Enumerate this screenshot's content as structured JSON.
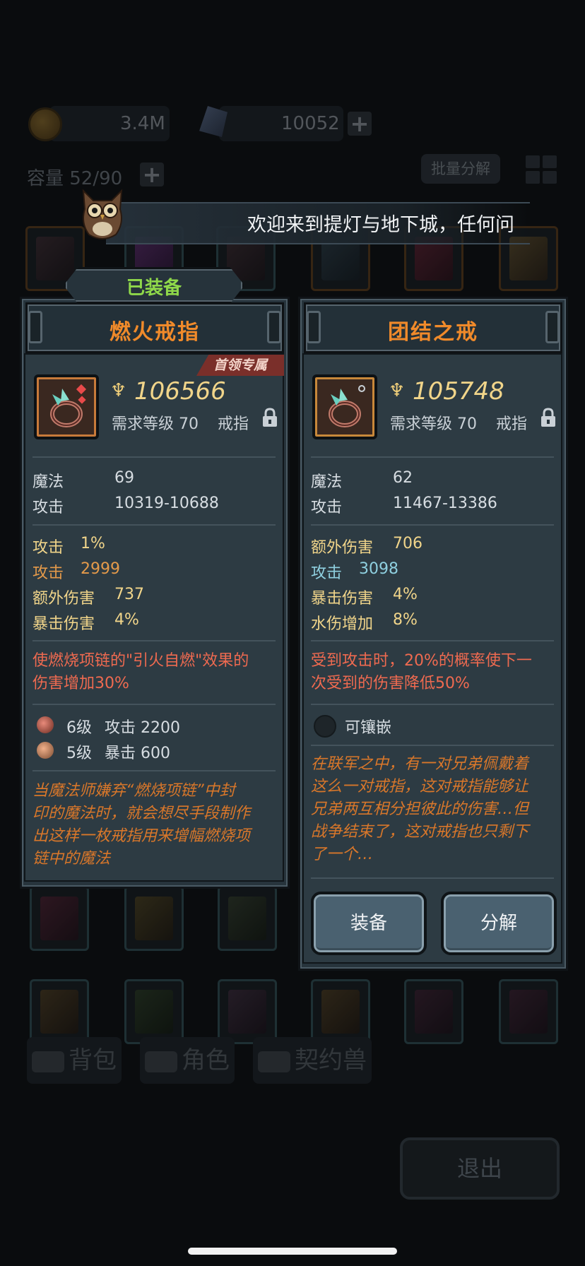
{
  "resources": {
    "coins": "3.4M",
    "gems": "10052"
  },
  "inventory": {
    "capacity": "容量 52/90",
    "batch_button": "批量分解"
  },
  "tabs": [
    {
      "label": "背包"
    },
    {
      "label": "角色"
    },
    {
      "label": "契约兽"
    }
  ],
  "exit_label": "退出",
  "banner_text": "欢迎来到提灯与地下城，任何问",
  "equipped_label": "已装备",
  "left_item": {
    "name": "燃火戒指",
    "tag": "首领专属",
    "score": "106566",
    "requirement": "需求等级 70",
    "type": "戒指",
    "base_stats": [
      {
        "label": "魔法",
        "value": "69"
      },
      {
        "label": "攻击",
        "value": "10319-10688"
      }
    ],
    "bonus_stats": [
      {
        "label": "攻击",
        "value": "1%",
        "color": "#f1d58a"
      },
      {
        "label": "攻击",
        "value": "2999",
        "color": "#e49a4a"
      },
      {
        "label": "额外伤害",
        "value": "737",
        "color": "#f1d58a"
      },
      {
        "label": "暴击伤害",
        "value": "4%",
        "color": "#f1d58a"
      }
    ],
    "effect_lines": [
      "使燃烧项链的\"引火自燃\"效果的",
      "伤害增加30%"
    ],
    "gems": [
      {
        "level": "6级",
        "stat": "攻击 2200"
      },
      {
        "level": "5级",
        "stat": "暴击 600"
      }
    ],
    "flavor_lines": [
      "当魔法师嫌弃“燃烧项链”中封",
      "印的魔法时，就会想尽手段制作",
      "出这样一枚戒指用来增幅燃烧项",
      "链中的魔法"
    ]
  },
  "right_item": {
    "name": "团结之戒",
    "score": "105748",
    "requirement": "需求等级 70",
    "type": "戒指",
    "base_stats": [
      {
        "label": "魔法",
        "value": "62"
      },
      {
        "label": "攻击",
        "value": "11467-13386"
      }
    ],
    "bonus_stats": [
      {
        "label": "额外伤害",
        "value": "706",
        "color": "#f1d58a"
      },
      {
        "label": "攻击",
        "value": "3098",
        "color": "#8fd0e0"
      },
      {
        "label": "暴击伤害",
        "value": "4%",
        "color": "#f1d58a"
      },
      {
        "label": "水伤增加",
        "value": "8%",
        "color": "#f1d58a"
      }
    ],
    "effect_lines": [
      "受到攻击时，20%的概率使下一",
      "次受到的伤害降低50%"
    ],
    "socket_label": "可镶嵌",
    "flavor_lines": [
      "在联军之中，有一对兄弟佩戴着",
      "这么一对戒指，这对戒指能够让",
      "兄弟两互相分担彼此的伤害…但",
      "战争结束了，这对戒指也只剩下",
      "了一个…"
    ],
    "equip_button": "装备",
    "dismantle_button": "分解"
  }
}
